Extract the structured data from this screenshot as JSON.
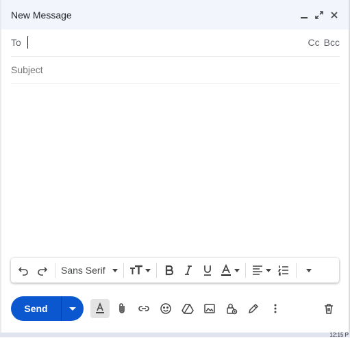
{
  "window": {
    "title": "New Message",
    "controls": [
      "minimize-icon",
      "expand-icon",
      "close-icon"
    ]
  },
  "to": {
    "label": "To",
    "value": ""
  },
  "cc": {
    "label": "Cc"
  },
  "bcc": {
    "label": "Bcc"
  },
  "subject": {
    "placeholder": "Subject",
    "value": ""
  },
  "body": {
    "value": ""
  },
  "format_toolbar": {
    "font": "Sans Serif",
    "icons": [
      "undo-icon",
      "redo-icon",
      "font-size-icon",
      "bold-icon",
      "italic-icon",
      "underline-icon",
      "text-color-icon",
      "align-icon",
      "numbered-list-icon",
      "more-formatting-icon"
    ]
  },
  "bottom_toolbar": {
    "send_label": "Send",
    "icons": [
      "formatting-options-icon",
      "attach-icon",
      "link-icon",
      "emoji-icon",
      "drive-icon",
      "photo-icon",
      "confidential-lock-icon",
      "signature-pen-icon",
      "more-options-icon",
      "trash-icon"
    ]
  },
  "taskbar": {
    "clock": "12:15 P"
  },
  "colors": {
    "header_bg": "#f2f6fc",
    "send_blue": "#0b57d0",
    "icon_gray": "#444746"
  }
}
